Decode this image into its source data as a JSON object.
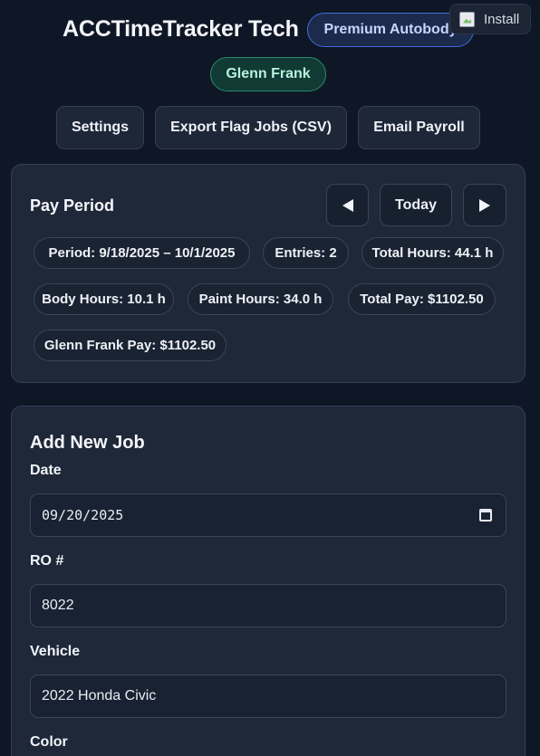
{
  "header": {
    "title": "ACCTimeTracker Tech",
    "brand_badge": "Premium Autobody",
    "user_badge": "Glenn Frank",
    "install_label": "Install"
  },
  "actions": {
    "settings_label": "Settings",
    "export_label": "Export Flag Jobs (CSV)",
    "email_label": "Email Payroll"
  },
  "pay_period": {
    "title": "Pay Period",
    "today_label": "Today",
    "prev_icon": "triangle-left-icon",
    "next_icon": "triangle-right-icon",
    "chips": {
      "period": "Period: 9/18/2025 – 10/1/2025",
      "entries": "Entries: 2",
      "total_hours": "Total Hours: 44.1 h",
      "body_hours": "Body Hours: 10.1 h",
      "paint_hours": "Paint Hours: 34.0 h",
      "total_pay": "Total Pay: $1102.50",
      "user_pay": "Glenn Frank Pay: $1102.50"
    }
  },
  "add_job": {
    "title": "Add New Job",
    "date_label": "Date",
    "date_value": "09/20/2025",
    "ro_label": "RO #",
    "ro_value": "8022",
    "vehicle_label": "Vehicle",
    "vehicle_value": "2022 Honda Civic",
    "color_label": "Color"
  },
  "colors": {
    "background": "#0f1726",
    "card": "#1e2838",
    "accent_blue": "#3f6ad8",
    "accent_green": "#2c8a6c"
  }
}
